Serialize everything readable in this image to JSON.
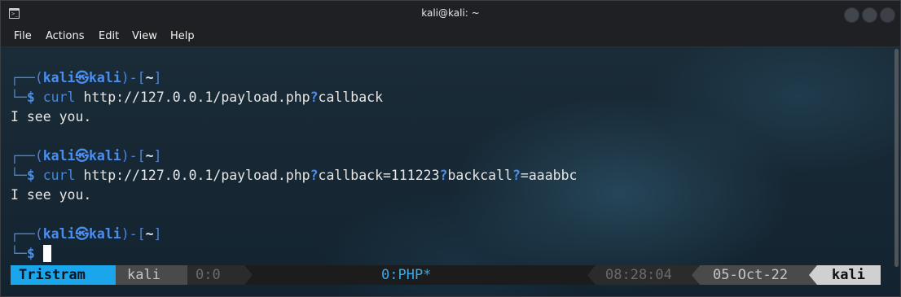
{
  "window": {
    "title": "kali@kali: ~"
  },
  "menu": {
    "items": [
      "File",
      "Actions",
      "Edit",
      "View",
      "Help"
    ]
  },
  "terminal": {
    "prompt": {
      "corner_top": "┌──",
      "open": "(",
      "user": "kali",
      "at_symbol": "㉿",
      "host": "kali",
      "close_mid": ")-[",
      "path": "~",
      "close": "]",
      "corner_bottom": "└─",
      "dollar": "$"
    },
    "commands": [
      {
        "prog": "curl",
        "parts": [
          "http://127.0.0.1/payload.php",
          "?",
          "callback"
        ],
        "output": "I see you."
      },
      {
        "prog": "curl",
        "parts": [
          "http://127.0.0.1/payload.php",
          "?",
          "callback=111223",
          "?",
          "backcall",
          "?",
          "=aaabbc"
        ],
        "output": "I see you."
      }
    ]
  },
  "status_bar": {
    "session": "Tristram",
    "host": "kali",
    "pane": "0:0",
    "window": "0:PHP*",
    "time": "08:28:04",
    "date": "05-Oct-22",
    "user": "kali"
  },
  "colors": {
    "prompt_blue": "#3d7fe6",
    "status_session_bg": "#1ba5ea",
    "window_name": "#39a9e8"
  },
  "icons": [
    "terminal-app-icon",
    "minimize-icon",
    "maximize-icon",
    "close-icon"
  ]
}
